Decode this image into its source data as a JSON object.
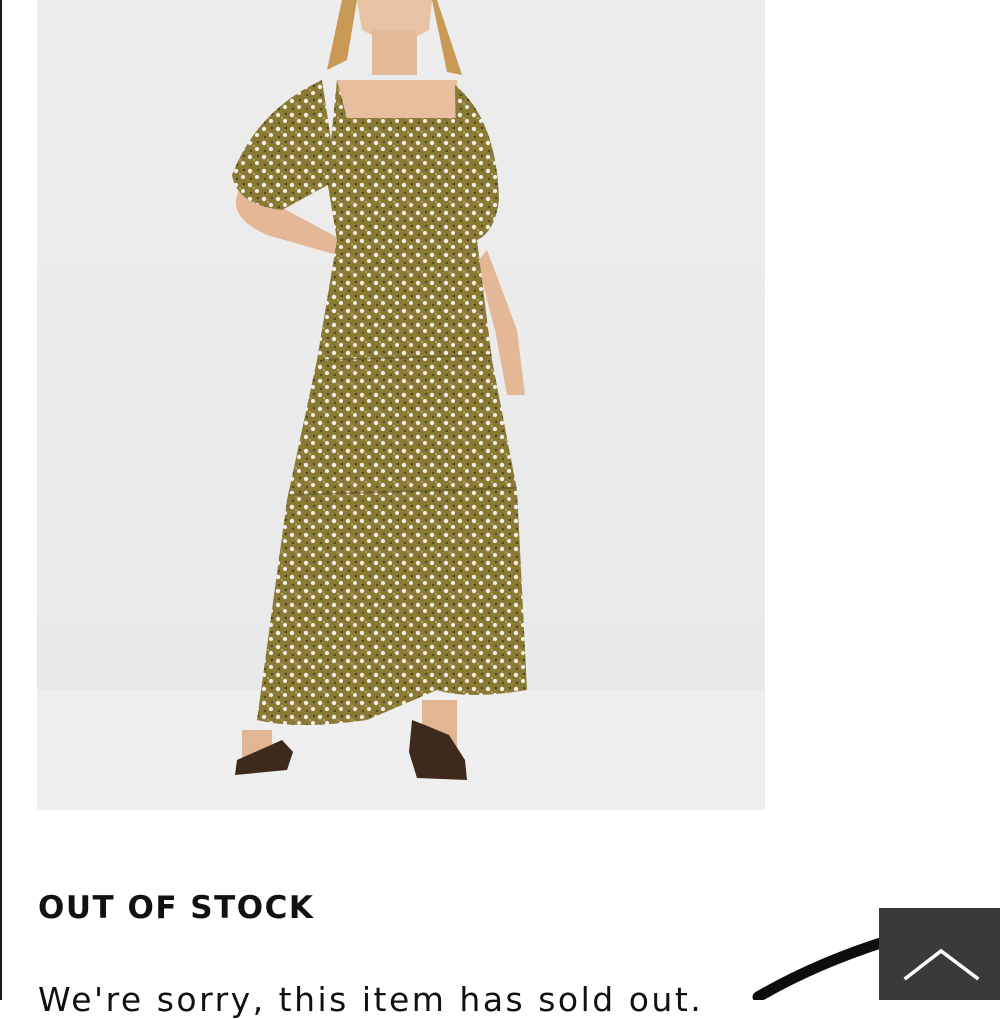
{
  "product": {
    "image_alt": "Model wearing a tiered floral smocked maxi dress"
  },
  "stock": {
    "heading": "OUT OF STOCK",
    "message": "We're sorry, this item has sold out."
  },
  "scroll_top": {
    "icon": "chevron-up-icon",
    "background": "#3a3a3a"
  },
  "colors": {
    "image_background": "#ececec",
    "dress_olive": "#8a7a35",
    "text": "#111111"
  }
}
